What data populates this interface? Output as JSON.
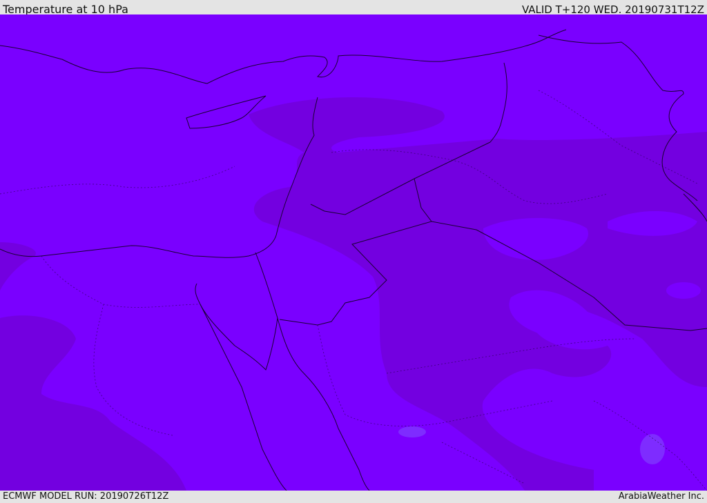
{
  "header": {
    "title": "Temperature at 10 hPa",
    "valid": "VALID T+120 WED. 20190731T12Z"
  },
  "footer": {
    "model_run": "ECMWF MODEL RUN: 20190726T12Z",
    "brand": "ArabiaWeather Inc."
  },
  "colors": {
    "field_base": "#7a00ff",
    "field_dark": "#7300e0",
    "field_light": "#7d20ff",
    "borders": "#1a0033",
    "bars": "#e4e4e4"
  }
}
